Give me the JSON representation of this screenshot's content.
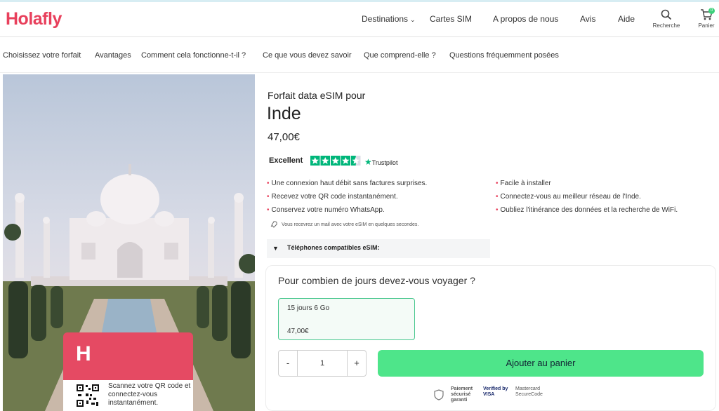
{
  "header": {
    "logo": "Holafly",
    "nav": [
      "Destinations",
      "Cartes SIM",
      "A propos de nous",
      "Avis",
      "Aide"
    ],
    "search_label": "Recherche",
    "cart_label": "Panier",
    "cart_count": "0"
  },
  "subnav": {
    "items": [
      "Choisissez votre forfait",
      "Avantages",
      "Comment cela fonctionne-t-il ?",
      "Ce que vous devez savoir",
      "Que comprend-elle ?",
      "Questions fréquemment posées"
    ]
  },
  "hero": {
    "brand_mark": "H",
    "card_text": "Scannez votre QR code et connectez-vous instantanément."
  },
  "product": {
    "subtitle": "Forfait data eSIM pour",
    "title": "Inde",
    "price": "47,00€",
    "rating_label": "Excellent",
    "rating_stars": 4.5,
    "trustpilot": "Trustpilot",
    "features_left": [
      "Une connexion haut débit sans factures surprises.",
      "Recevez votre QR code instantanément.",
      "Conservez votre numéro WhatsApp."
    ],
    "features_right": [
      "Facile à installer",
      "Connectez-vous au meilleur réseau de l'Inde.",
      "Oubliez l'itinérance des données et la recherche de WiFi."
    ],
    "email_note": "Vous recevrez un mail avec votre eSIM en quelques secondes.",
    "compat_label": "Téléphones compatibles eSIM:"
  },
  "purchase": {
    "question": "Pour combien de jours devez-vous voyager ?",
    "plan_name": "15 jours 6 Go",
    "plan_price": "47,00€",
    "minus": "-",
    "quantity": "1",
    "plus": "+",
    "add_to_cart": "Ajouter au panier"
  },
  "payment": {
    "secure": "Paiement sécurisé garanti",
    "visa": "Verified by VISA",
    "mastercard": "Mastercard SecureCode"
  },
  "colors": {
    "brand": "#e8405c",
    "accent_green": "#4ee58a",
    "trustpilot_green": "#00b67a"
  }
}
